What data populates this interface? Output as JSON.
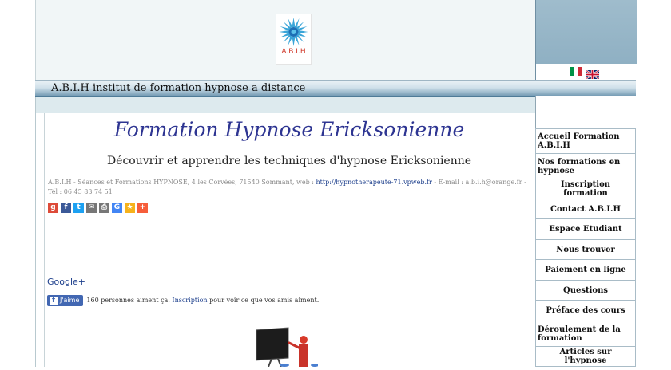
{
  "header": {
    "logo_text": "A.B.I.H",
    "site_title": "A.B.I.H institut de formation hypnose a distance"
  },
  "main": {
    "heading": "Formation Hypnose Ericksonienne",
    "subheading": "Découvrir et apprendre les techniques d'hypnose Ericksonienne",
    "address_before": "A.B.I.H - Séances et Formations HYPNOSE, 4 les Corvées, 71540 Sommant, web : ",
    "address_link": "http://hypnotherapeute-71.vpweb.fr",
    "address_after": " - E-mail : a.b.i.h@orange.fr - Tél : 06 45 83 74 51",
    "share_icons": [
      "google-plus-icon",
      "facebook-icon",
      "twitter-icon",
      "email-icon",
      "print-icon",
      "google-icon",
      "favorite-star-icon",
      "more-plus-icon"
    ],
    "google_plus_label": "Google+",
    "like_button_label": "J'aime",
    "like_text_before": "160 personnes aiment ça. ",
    "like_link": "Inscription",
    "like_text_after": " pour voir ce que vos amis aiment."
  },
  "nav": {
    "items": [
      {
        "label": "Accueil Formation A.B.I.H",
        "align": "left"
      },
      {
        "label": "Nos formations en hypnose",
        "align": "left"
      },
      {
        "label": "Inscription formation",
        "align": "center"
      },
      {
        "label": "Contact A.B.I.H",
        "align": "center"
      },
      {
        "label": "Espace Etudiant",
        "align": "center"
      },
      {
        "label": "Nous trouver",
        "align": "center"
      },
      {
        "label": "Paiement en ligne",
        "align": "center"
      },
      {
        "label": "Questions",
        "align": "center"
      },
      {
        "label": "Préface des cours",
        "align": "center"
      },
      {
        "label": "Déroulement de la formation",
        "align": "left"
      },
      {
        "label": "Articles sur l'hypnose",
        "align": "center"
      }
    ]
  },
  "colors": {
    "heading": "#2e3592",
    "link": "#1d3f8c",
    "title_bar_dark": "#6e96b0",
    "right_top": "#9fbccc"
  }
}
